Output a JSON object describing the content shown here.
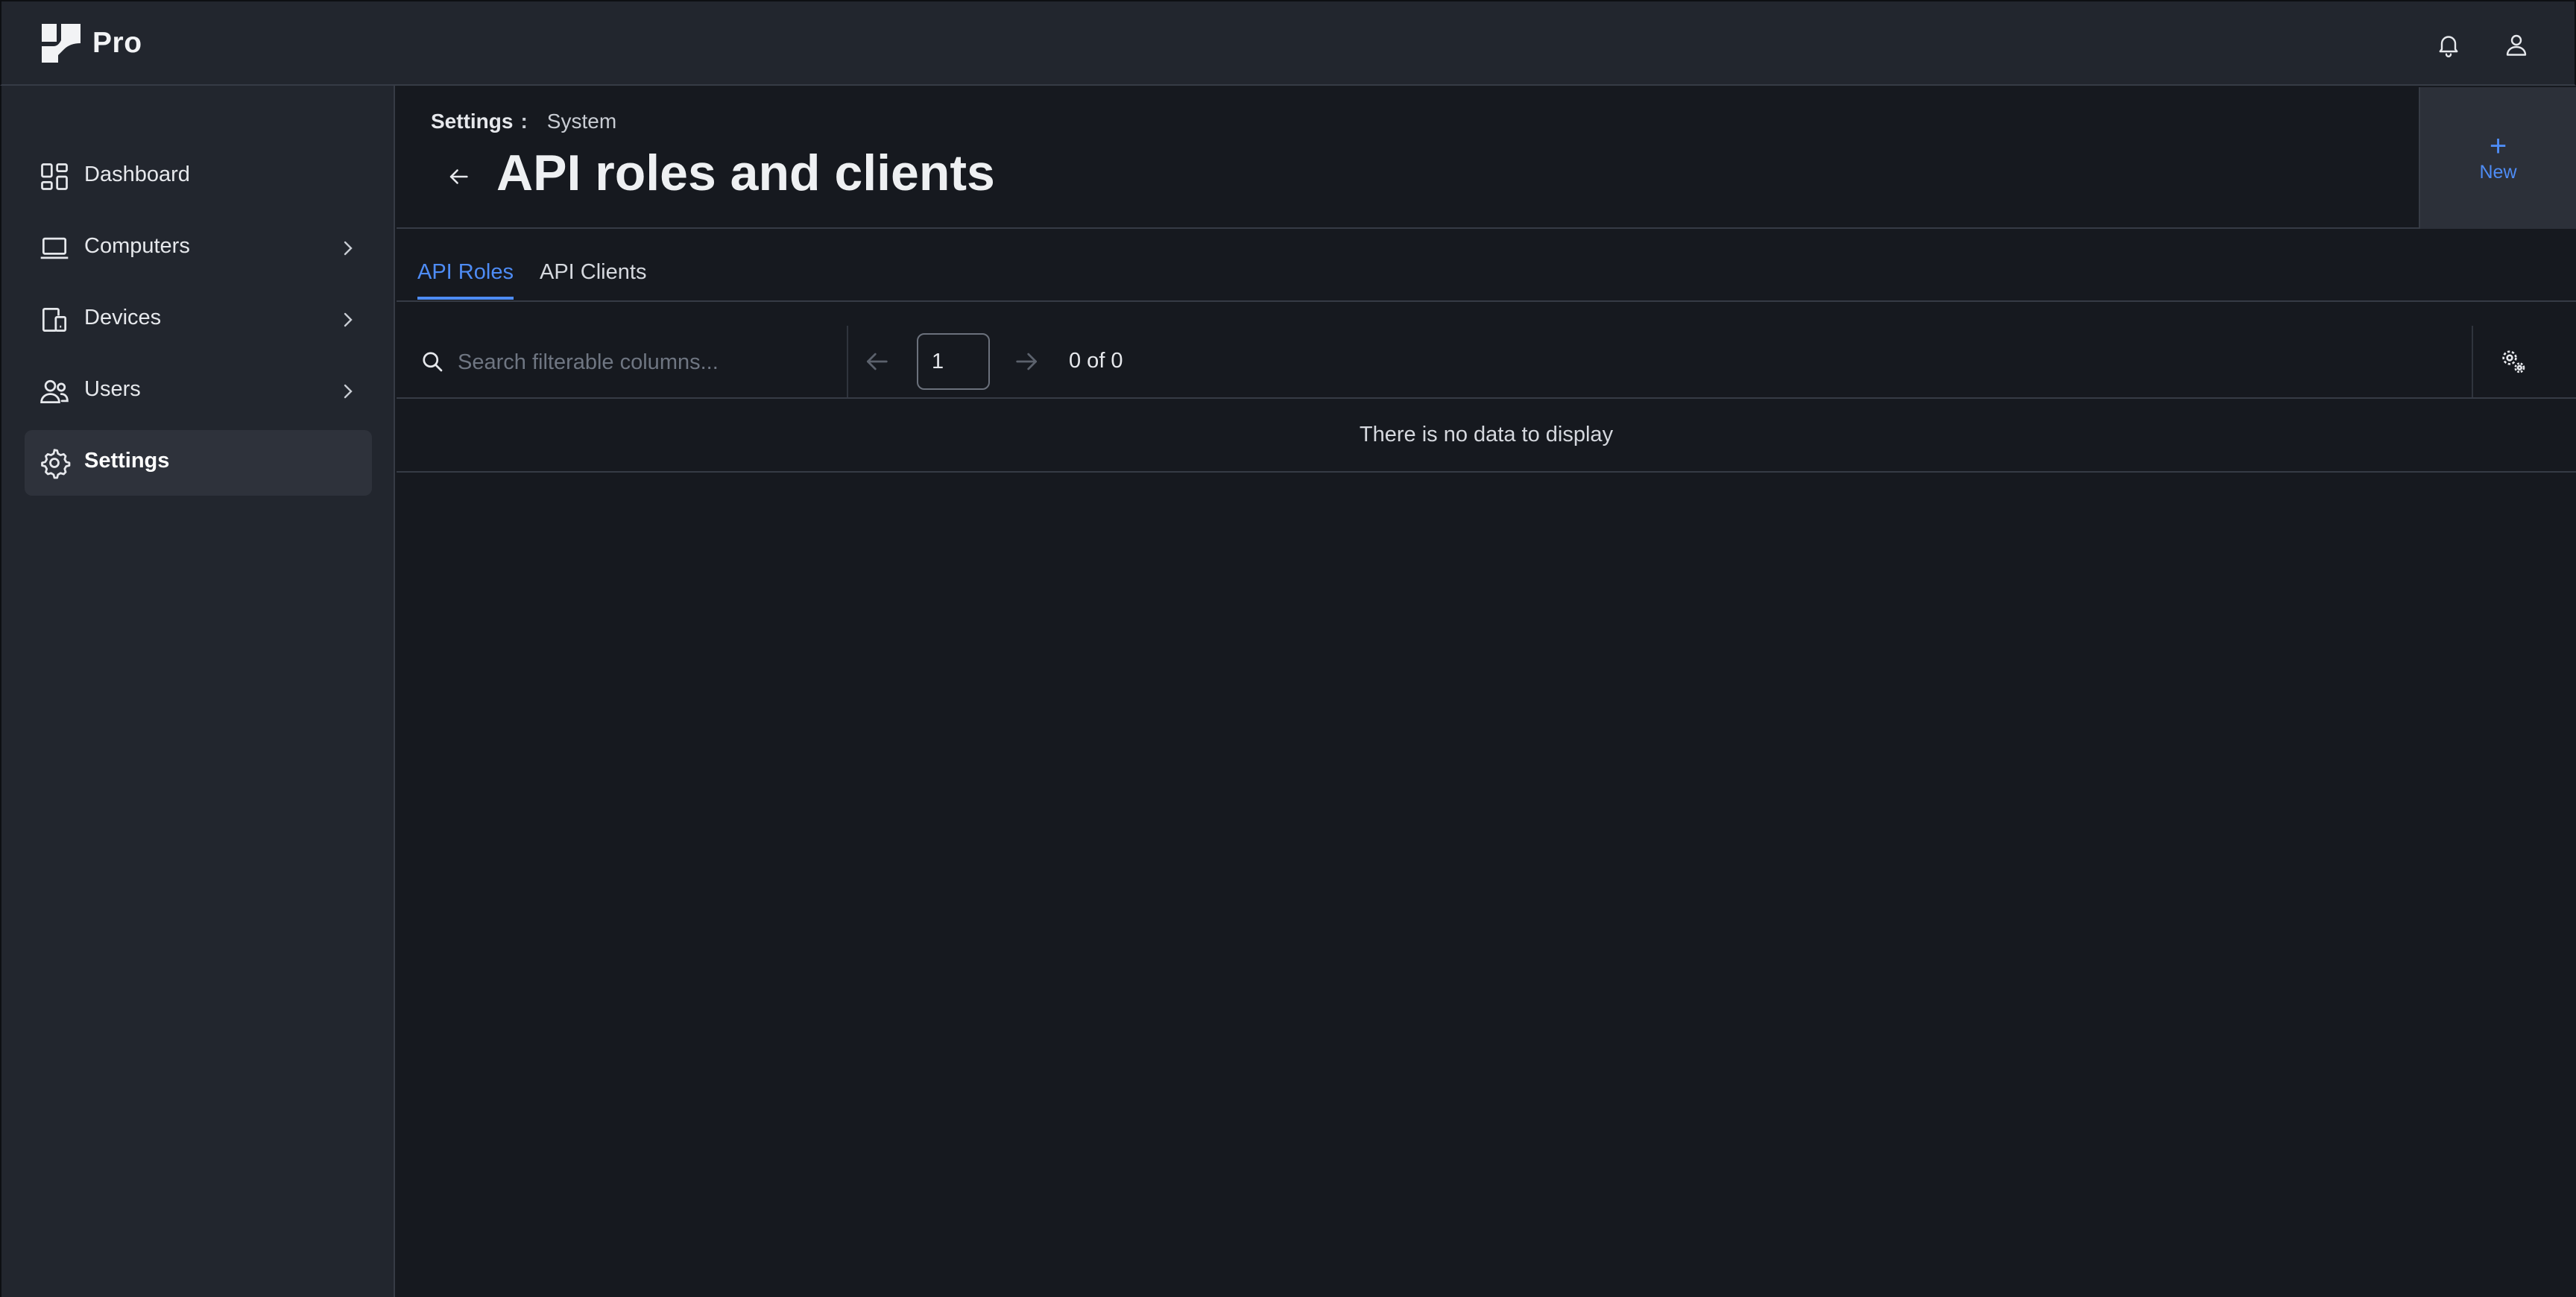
{
  "app": {
    "name": "Pro"
  },
  "header": {
    "notifications_icon": "bell-icon",
    "profile_icon": "user-icon"
  },
  "sidebar": {
    "items": [
      {
        "label": "Dashboard",
        "icon": "dashboard-icon",
        "expandable": false,
        "active": false
      },
      {
        "label": "Computers",
        "icon": "laptop-icon",
        "expandable": true,
        "active": false
      },
      {
        "label": "Devices",
        "icon": "devices-icon",
        "expandable": true,
        "active": false
      },
      {
        "label": "Users",
        "icon": "users-icon",
        "expandable": true,
        "active": false
      },
      {
        "label": "Settings",
        "icon": "gear-icon",
        "expandable": false,
        "active": true
      }
    ]
  },
  "page": {
    "breadcrumb": {
      "root": "Settings",
      "separator": ":",
      "current": "System"
    },
    "title": "API roles and clients",
    "new_button": {
      "icon": "+",
      "label": "New"
    }
  },
  "tabs": [
    {
      "label": "API Roles",
      "active": true
    },
    {
      "label": "API Clients",
      "active": false
    }
  ],
  "table": {
    "search_placeholder": "Search filterable columns...",
    "page_value": "1",
    "page_count": "0 of 0",
    "empty_message": "There is no data to display"
  },
  "colors": {
    "accent": "#4e8cf5",
    "background": "#16191f",
    "panel": "#22262e"
  }
}
